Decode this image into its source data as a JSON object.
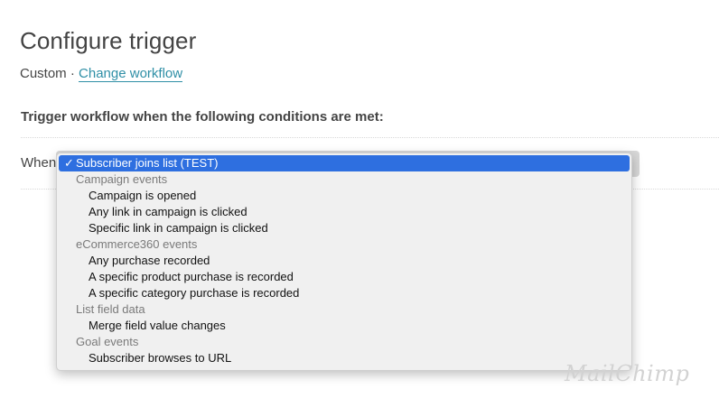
{
  "header": {
    "title": "Configure trigger",
    "workflow_type": "Custom",
    "separator": " · ",
    "change_link": "Change workflow"
  },
  "conditions": {
    "heading": "Trigger workflow when the following conditions are met:",
    "when_label": "When",
    "selected_value": "Subscriber joins list (TEST)",
    "checkmark": "✓",
    "groups": [
      {
        "label": "Campaign events",
        "options": [
          "Campaign is opened",
          "Any link in campaign is clicked",
          "Specific link in campaign is clicked"
        ]
      },
      {
        "label": "eCommerce360 events",
        "options": [
          "Any purchase recorded",
          "A specific product purchase is recorded",
          "A specific category purchase is recorded"
        ]
      },
      {
        "label": "List field data",
        "options": [
          "Merge field value changes"
        ]
      },
      {
        "label": "Goal events",
        "options": [
          "Subscriber browses to URL"
        ]
      }
    ]
  },
  "watermark": "MailChimp",
  "colors": {
    "link": "#2f8fa6",
    "selection": "#2e6fe0"
  }
}
